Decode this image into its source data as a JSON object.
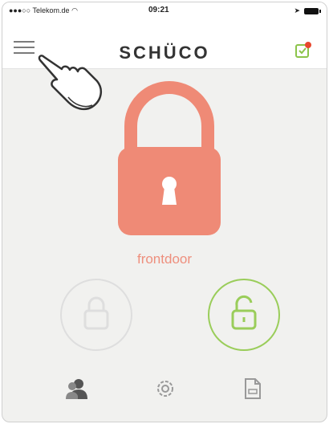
{
  "status_bar": {
    "carrier": "Telekom.de",
    "time": "09:21"
  },
  "header": {
    "brand": "SCHÜCO"
  },
  "lock": {
    "name": "frontdoor",
    "state": "locked"
  },
  "colors": {
    "lock_accent": "#ef8a76",
    "unlock_accent": "#9acd5a",
    "inactive": "#dedede"
  },
  "icons": {
    "menu": "hamburger-menu-icon",
    "notify": "notification-icon",
    "lock": "padlock-closed-icon",
    "unlock": "padlock-open-icon",
    "users": "users-icon",
    "settings": "gear-icon",
    "docs": "document-icon"
  }
}
